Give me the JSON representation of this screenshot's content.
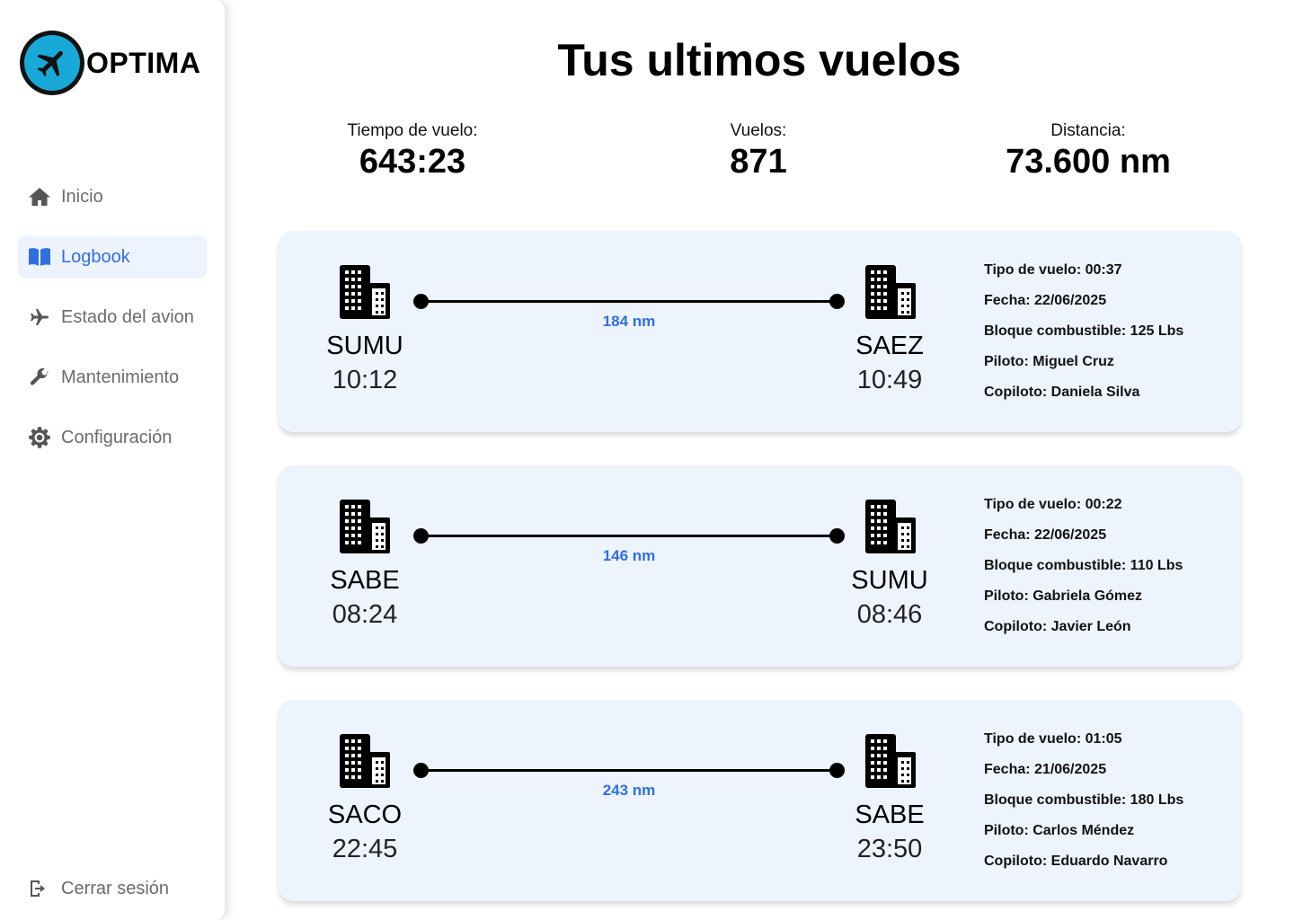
{
  "brand": {
    "name": "OPTIMA"
  },
  "nav": {
    "items": [
      {
        "label": "Inicio",
        "icon": "home-icon"
      },
      {
        "label": "Logbook",
        "icon": "book-icon",
        "active": true
      },
      {
        "label": "Estado del avion",
        "icon": "plane-icon"
      },
      {
        "label": "Mantenimiento",
        "icon": "wrench-icon"
      },
      {
        "label": "Configuración",
        "icon": "gear-icon"
      }
    ],
    "logout": "Cerrar sesión"
  },
  "title": "Tus ultimos vuelos",
  "stats": {
    "flight_time": {
      "label": "Tiempo de vuelo:",
      "value": "643:23"
    },
    "flights": {
      "label": "Vuelos:",
      "value": "871"
    },
    "distance": {
      "label": "Distancia:",
      "value": "73.600 nm"
    }
  },
  "colors": {
    "accent": "#2f6fdf",
    "card_bg": "#eef4fd",
    "logo": "#19a9d8"
  },
  "flights": [
    {
      "origin": "SUMU",
      "dep": "10:12",
      "dest": "SAEZ",
      "arr": "10:49",
      "distance": "184 nm",
      "tipo": "Tipo de vuelo: 00:37",
      "fecha": "Fecha: 22/06/2025",
      "combustible": "Bloque combustible: 125 Lbs",
      "piloto": "Piloto: Miguel Cruz",
      "copiloto": "Copiloto: Daniela Silva"
    },
    {
      "origin": "SABE",
      "dep": "08:24",
      "dest": "SUMU",
      "arr": "08:46",
      "distance": "146 nm",
      "tipo": "Tipo de vuelo: 00:22",
      "fecha": "Fecha: 22/06/2025",
      "combustible": "Bloque combustible: 110 Lbs",
      "piloto": "Piloto: Gabriela Gómez",
      "copiloto": "Copiloto: Javier León"
    },
    {
      "origin": "SACO",
      "dep": "22:45",
      "dest": "SABE",
      "arr": "23:50",
      "distance": "243 nm",
      "tipo": "Tipo de vuelo: 01:05",
      "fecha": "Fecha: 21/06/2025",
      "combustible": "Bloque combustible: 180 Lbs",
      "piloto": "Piloto: Carlos Méndez",
      "copiloto": "Copiloto: Eduardo Navarro"
    }
  ]
}
